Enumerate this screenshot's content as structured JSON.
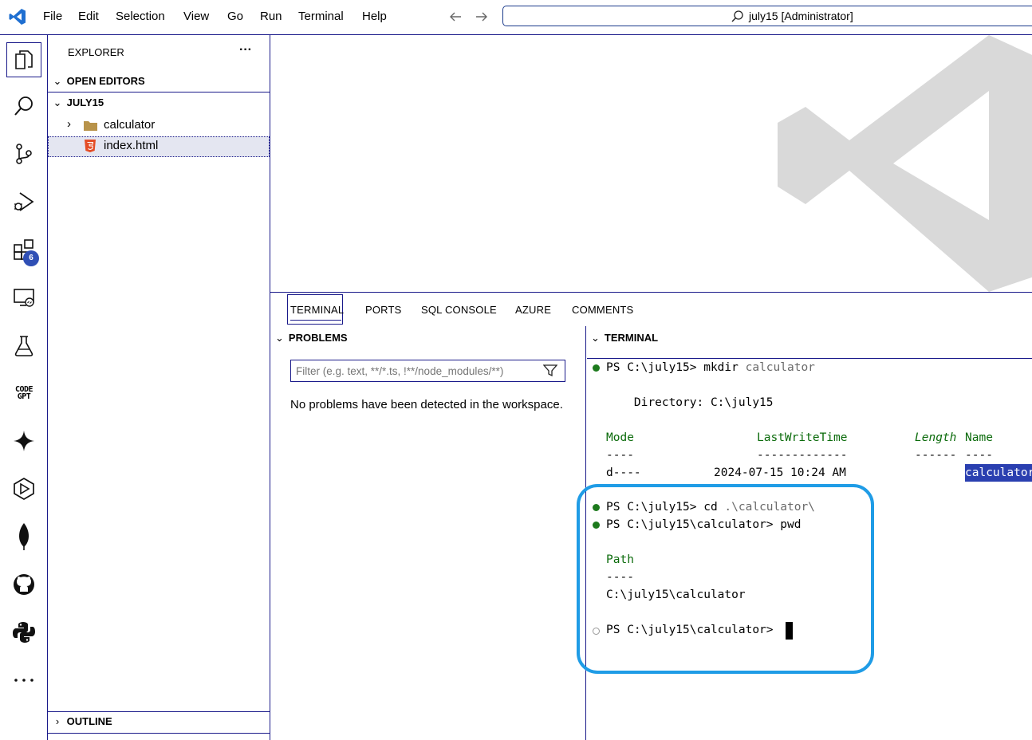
{
  "menu": [
    "File",
    "Edit",
    "Selection",
    "View",
    "Go",
    "Run",
    "Terminal",
    "Help"
  ],
  "command_center": {
    "text": "july15 [Administrator]"
  },
  "activity_bar": {
    "extensions_badge": "6",
    "codegpt_label_1": "CODE",
    "codegpt_label_2": "GPT"
  },
  "explorer": {
    "title": "EXPLORER",
    "more": "···",
    "open_editors": "OPEN EDITORS",
    "folder": "JULY15",
    "items": [
      {
        "label": "calculator",
        "type": "folder"
      },
      {
        "label": "index.html",
        "type": "html"
      }
    ],
    "outline": "OUTLINE"
  },
  "panel": {
    "tabs": [
      "TERMINAL",
      "PORTS",
      "SQL CONSOLE",
      "AZURE",
      "COMMENTS"
    ],
    "problems": {
      "title": "PROBLEMS",
      "filter_placeholder": "Filter (e.g. text, **/*.ts, !**/node_modules/**)",
      "message": "No problems have been detected in the workspace."
    },
    "terminal": {
      "title": "TERMINAL",
      "cmd1_prompt": "PS C:\\july15> ",
      "cmd1_cmd": "mkdir",
      "cmd1_arg": " calculator",
      "directory_line": "    Directory: C:\\july15",
      "col_mode": "Mode",
      "col_lwt": "LastWriteTime",
      "col_length": "Length",
      "col_name": "Name",
      "dash_mode": "----",
      "dash_lwt": "-------------",
      "dash_length": "------",
      "dash_name": "----",
      "row_mode": "d----",
      "row_lwt": "2024-07-15 10:24 AM",
      "row_name": "calculator",
      "cmd2_prompt": "PS C:\\july15> ",
      "cmd2_cmd": "cd",
      "cmd2_arg": " .\\calculator\\",
      "cmd3_prompt": "PS C:\\july15\\calculator> ",
      "cmd3_cmd": "pwd",
      "path_header": "Path",
      "path_dash": "----",
      "path_value": "C:\\july15\\calculator",
      "cmd4_prompt": "PS C:\\july15\\calculator> "
    }
  },
  "colors": {
    "accent": "#1a1a8a",
    "badge": "#2f4fb5",
    "highlight": "#1f9ce6",
    "success": "#1d7a1d",
    "selection": "#2a3fb0"
  }
}
